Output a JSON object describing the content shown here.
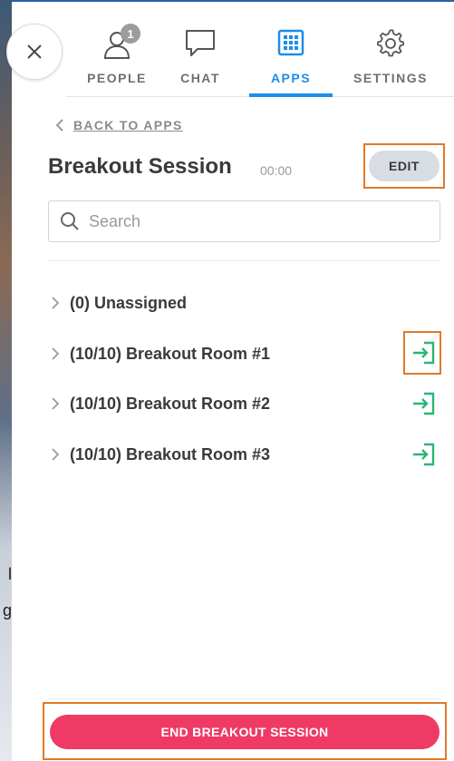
{
  "background": {
    "text_lines": [
      "l",
      "g"
    ]
  },
  "tabs": [
    {
      "label": "PEOPLE",
      "icon": "people-icon",
      "badge": "1"
    },
    {
      "label": "CHAT",
      "icon": "chat-icon"
    },
    {
      "label": "APPS",
      "icon": "apps-grid-icon",
      "active": true
    },
    {
      "label": "SETTINGS",
      "icon": "gear-icon"
    }
  ],
  "back": {
    "label": "BACK TO APPS"
  },
  "session": {
    "title": "Breakout Session",
    "timer": "00:00",
    "edit_label": "EDIT"
  },
  "search": {
    "placeholder": "Search",
    "value": ""
  },
  "rooms": [
    {
      "label": "(0) Unassigned",
      "has_join": false
    },
    {
      "label": "(10/10) Breakout Room #1",
      "has_join": true
    },
    {
      "label": "(10/10) Breakout Room #2",
      "has_join": true
    },
    {
      "label": "(10/10) Breakout Room #3",
      "has_join": true
    }
  ],
  "end_button": {
    "label": "END BREAKOUT SESSION"
  },
  "colors": {
    "accent": "#1c8ee8",
    "join": "#2bb673",
    "end": "#ef3a66",
    "highlight": "#e07a2a"
  }
}
